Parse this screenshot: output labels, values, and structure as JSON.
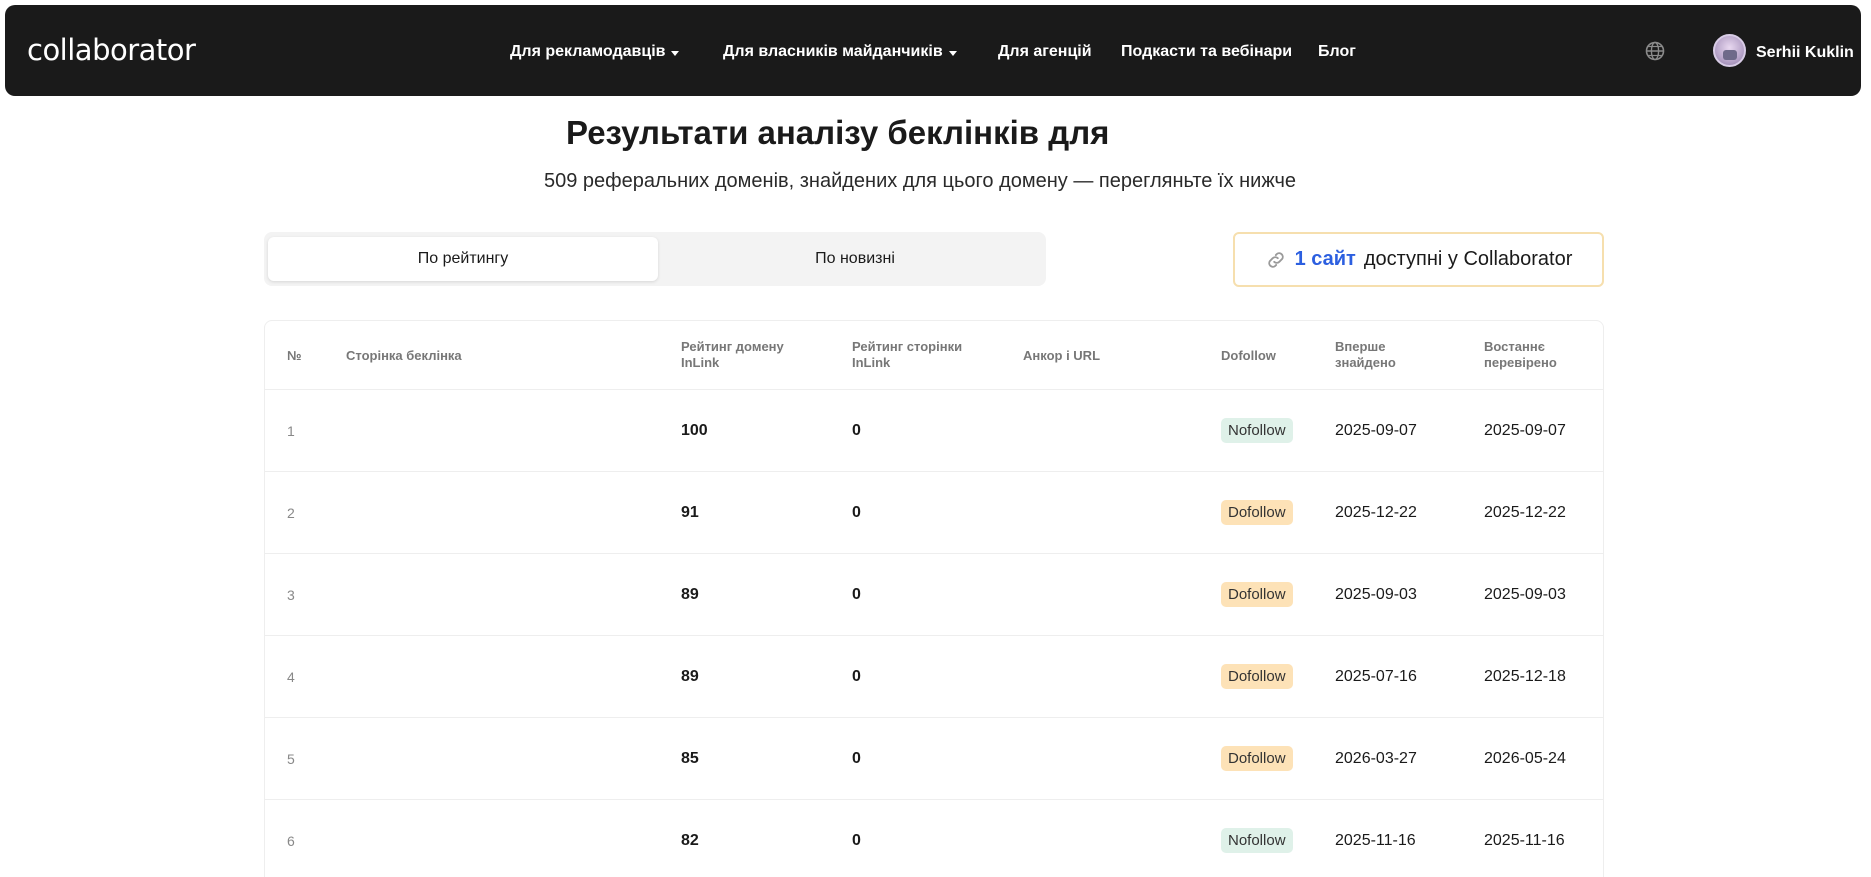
{
  "navbar": {
    "logo": "collaborator",
    "items": [
      {
        "label": "Для рекламодавців",
        "dropdown": true
      },
      {
        "label": "Для власників майданчиків",
        "dropdown": true
      },
      {
        "label": "Для агенцій",
        "dropdown": false
      },
      {
        "label": "Подкасти та вебінари",
        "dropdown": false
      },
      {
        "label": "Блог",
        "dropdown": false
      }
    ],
    "user_name": "Serhii Kuklin",
    "icons": [
      "globe-icon",
      "avatar"
    ]
  },
  "header": {
    "title": "Результати аналізу беклінків для",
    "subtitle": "509 реферальних доменів, знайдених для цього домену — перегляньте їх нижче"
  },
  "sort": {
    "options": [
      "По рейтингу",
      "По новизні"
    ],
    "active": "По рейтингу"
  },
  "available": {
    "count": "1 сайт",
    "text": "доступні у Collaborator",
    "icon": "link-icon"
  },
  "table": {
    "headers": {
      "num": "№",
      "page": "Сторінка беклінка",
      "domain_rating_1": "Рейтинг домену",
      "domain_rating_2": "InLink",
      "page_rating_1": "Рейтинг сторінки",
      "page_rating_2": "InLink",
      "anchor": "Анкор і URL",
      "dofollow": "Dofollow",
      "first_1": "Вперше",
      "first_2": "знайдено",
      "last_1": "Востаннє",
      "last_2": "перевірено"
    },
    "rows": [
      {
        "num": "1",
        "domain_rating": "100",
        "page_rating": "0",
        "follow": "Nofollow",
        "first": "2025-09-07",
        "last": "2025-09-07"
      },
      {
        "num": "2",
        "domain_rating": "91",
        "page_rating": "0",
        "follow": "Dofollow",
        "first": "2025-12-22",
        "last": "2025-12-22"
      },
      {
        "num": "3",
        "domain_rating": "89",
        "page_rating": "0",
        "follow": "Dofollow",
        "first": "2025-09-03",
        "last": "2025-09-03"
      },
      {
        "num": "4",
        "domain_rating": "89",
        "page_rating": "0",
        "follow": "Dofollow",
        "first": "2025-07-16",
        "last": "2025-12-18"
      },
      {
        "num": "5",
        "domain_rating": "85",
        "page_rating": "0",
        "follow": "Dofollow",
        "first": "2026-03-27",
        "last": "2026-05-24"
      },
      {
        "num": "6",
        "domain_rating": "82",
        "page_rating": "0",
        "follow": "Nofollow",
        "first": "2025-11-16",
        "last": "2025-11-16"
      }
    ]
  },
  "colors": {
    "navbar_bg": "#1a1a1a",
    "accent_blue": "#2c5fe0",
    "nofollow_bg": "#dff1e9",
    "dofollow_bg": "#fde2b7"
  }
}
